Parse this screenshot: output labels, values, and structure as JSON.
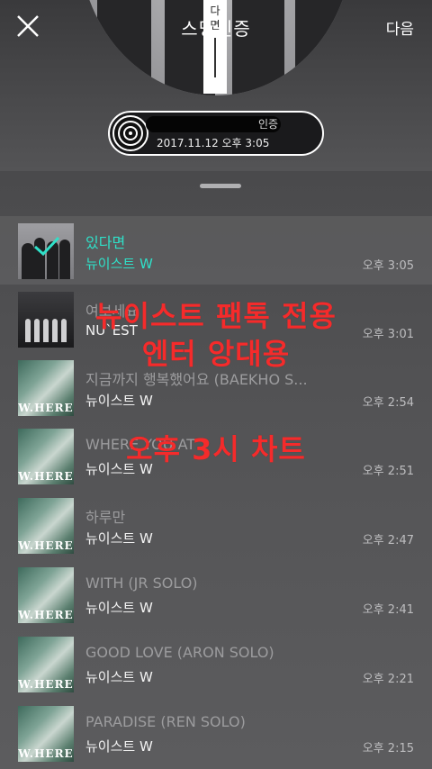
{
  "header": {
    "title": "스밍인증",
    "title_overlay_chars": [
      "다",
      "면"
    ],
    "next_label": "다음"
  },
  "certificate": {
    "label_suffix": "인증",
    "datetime": "2017.11.12 오후 3:05"
  },
  "list_hint": "",
  "tracks": [
    {
      "title": "있다면",
      "artist": "뉴이스트 W",
      "time": "오후 3:05",
      "selected": true,
      "cover": "photo"
    },
    {
      "title": "여보세요",
      "artist": "NU`EST",
      "time": "오후 3:01",
      "selected": false,
      "cover": "photo2"
    },
    {
      "title": "지금까지 행복했어요 (BAEKHO S...",
      "artist": "뉴이스트 W",
      "time": "오후 2:54",
      "selected": false,
      "cover": "where"
    },
    {
      "title": "WHERE YOU AT",
      "artist": "뉴이스트 W",
      "time": "오후 2:51",
      "selected": false,
      "cover": "where"
    },
    {
      "title": "하루만",
      "artist": "뉴이스트 W",
      "time": "오후 2:47",
      "selected": false,
      "cover": "where"
    },
    {
      "title": "WITH (JR SOLO)",
      "artist": "뉴이스트 W",
      "time": "오후 2:41",
      "selected": false,
      "cover": "where"
    },
    {
      "title": "GOOD LOVE (ARON SOLO)",
      "artist": "뉴이스트 W",
      "time": "오후 2:21",
      "selected": false,
      "cover": "where"
    },
    {
      "title": "PARADISE (REN SOLO)",
      "artist": "뉴이스트 W",
      "time": "오후 2:15",
      "selected": false,
      "cover": "where"
    }
  ],
  "cover_label": "W.HERE",
  "overlay_text": {
    "line1": "뉴이스트 팬톡 전용",
    "line2": "엔터 앙대용",
    "line3": "오후 3시 차트"
  },
  "icons": {
    "close": "close-icon",
    "check": "check-icon",
    "record": "record-icon"
  },
  "colors": {
    "accent": "#2fe0c8",
    "overlay": "#f52b2b"
  }
}
